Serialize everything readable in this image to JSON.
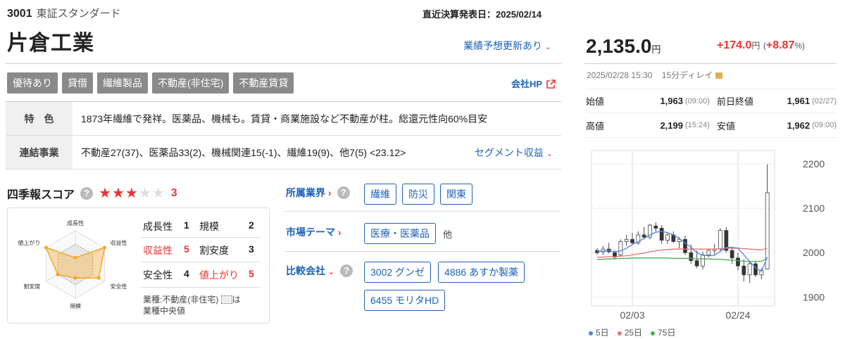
{
  "header": {
    "code": "3001",
    "market": "東証スタンダード",
    "announce": "直近決算発表日：2025/02/14",
    "company": "片倉工業",
    "forecast": "業績予想更新あり",
    "company_hp": "会社HP"
  },
  "tags": [
    "優待あり",
    "貸借",
    "繊維製品",
    "不動産(非住宅)",
    "不動産賃貸"
  ],
  "info": {
    "feature_label": "特　色",
    "feature_text": "1873年繊維で発祥。医薬品、機械も。賃貸・商業施設など不動産が柱。総還元性向60%目安",
    "segment_label": "連結事業",
    "segment_text": "不動産27(37)、医薬品33(2)、機械関連15(-1)、繊維19(9)、他7(5) <23.12>",
    "segment_link": "セグメント収益"
  },
  "score": {
    "title": "四季報スコア",
    "help": "?",
    "stars_filled": 3,
    "stars_total": 5,
    "value": "3",
    "items": [
      {
        "name": "成長性",
        "value": "1"
      },
      {
        "name": "規模",
        "value": "2"
      },
      {
        "name": "収益性",
        "value": "5"
      },
      {
        "name": "割安度",
        "value": "3"
      },
      {
        "name": "安全性",
        "value": "4"
      },
      {
        "name": "値上がり",
        "value": "5"
      }
    ],
    "radar_labels": [
      "成長性",
      "収益性",
      "安全性",
      "規模",
      "割安度",
      "値上がり"
    ],
    "radar_values": [
      1,
      5,
      4,
      2,
      3,
      5
    ],
    "note": "業種:不動産(非住宅)",
    "note_tail": "は",
    "note2": "業種中央値"
  },
  "industry": {
    "label": "所属業界",
    "chips": [
      "繊維",
      "防災",
      "関東"
    ]
  },
  "theme": {
    "label": "市場テーマ",
    "chips": [
      "医療・医薬品"
    ],
    "other": "他"
  },
  "compare": {
    "label": "比較会社",
    "chips": [
      "3002 グンゼ",
      "4886 あすか製薬",
      "6455 モリタHD"
    ]
  },
  "quote": {
    "price": "2,135.0",
    "unit": "円",
    "change": "+174.0",
    "change_unit": "円",
    "pct_open": "(",
    "pct": "+8.87",
    "pct_close": "%)",
    "datetime": "2025/02/28 15:30",
    "delay": "15分ディレイ",
    "open_label": "始値",
    "open": "1,963",
    "open_time": "(09:00)",
    "prev_label": "前日終値",
    "prev": "1,961",
    "prev_time": "(02/27)",
    "high_label": "高値",
    "high": "2,199",
    "high_time": "(15:24)",
    "low_label": "安値",
    "low": "1,962",
    "low_time": "(09:00)"
  },
  "chart_data": {
    "type": "candlestick",
    "x_ticks": [
      "02/03",
      "02/24"
    ],
    "y_ticks": [
      "2200",
      "2100",
      "2000",
      "1900"
    ],
    "ylim": [
      1880,
      2230
    ],
    "legend": [
      "5日",
      "25日",
      "75日"
    ],
    "colors": {
      "ma5": "#4a86e8",
      "ma25": "#e57373",
      "ma75": "#4caf50"
    },
    "candles": [
      [
        2005,
        2010,
        1995,
        2000
      ],
      [
        2002,
        2015,
        1995,
        2008
      ],
      [
        2008,
        2022,
        1998,
        2002
      ],
      [
        2000,
        2005,
        1985,
        1990
      ],
      [
        1995,
        2030,
        1992,
        2025
      ],
      [
        2025,
        2040,
        2015,
        2030
      ],
      [
        2030,
        2045,
        2018,
        2022
      ],
      [
        2022,
        2048,
        2018,
        2040
      ],
      [
        2040,
        2058,
        2030,
        2035
      ],
      [
        2035,
        2065,
        2030,
        2062
      ],
      [
        2060,
        2068,
        2048,
        2055
      ],
      [
        2055,
        2062,
        2020,
        2028
      ],
      [
        2028,
        2045,
        2020,
        2040
      ],
      [
        2040,
        2048,
        2022,
        2025
      ],
      [
        2025,
        2035,
        2010,
        2030
      ],
      [
        2030,
        2038,
        1995,
        2000
      ],
      [
        2000,
        2018,
        1975,
        1982
      ],
      [
        1982,
        2005,
        1965,
        1970
      ],
      [
        1970,
        2002,
        1962,
        1995
      ],
      [
        1995,
        2008,
        1990,
        2005
      ],
      [
        2005,
        2020,
        1995,
        2008
      ],
      [
        2008,
        2055,
        2002,
        2050
      ],
      [
        2050,
        2058,
        2000,
        2005
      ],
      [
        2005,
        2012,
        1975,
        1988
      ],
      [
        1988,
        2000,
        1960,
        1970
      ],
      [
        1970,
        1985,
        1935,
        1950
      ],
      [
        1950,
        1982,
        1932,
        1975
      ],
      [
        1975,
        1982,
        1945,
        1950
      ],
      [
        1950,
        1965,
        1940,
        1960
      ],
      [
        1963,
        2199,
        1962,
        2135
      ]
    ],
    "ma5": [
      2003,
      2003,
      2005,
      2002,
      2004,
      2010,
      2018,
      2025,
      2032,
      2040,
      2046,
      2048,
      2045,
      2040,
      2032,
      2022,
      2012,
      2000,
      1994,
      1993,
      1994,
      2003,
      2012,
      2012,
      2010,
      1995,
      1980,
      1966,
      1958,
      1990
    ],
    "ma25": [
      1990,
      1990,
      1991,
      1991,
      1992,
      1993,
      1995,
      1997,
      1999,
      2002,
      2004,
      2006,
      2007,
      2008,
      2008,
      2008,
      2008,
      2008,
      2008,
      2008,
      2008,
      2009,
      2010,
      2010,
      2010,
      2009,
      2008,
      2007,
      2006,
      2010
    ],
    "ma75": [
      1985,
      1985,
      1986,
      1986,
      1987,
      1987,
      1988,
      1988,
      1988,
      1988,
      1988,
      1988,
      1988,
      1987,
      1987,
      1987,
      1987,
      1986,
      1986,
      1986,
      1985,
      1985,
      1984,
      1983,
      1982,
      1981,
      1980,
      1980,
      1981,
      1986
    ]
  }
}
